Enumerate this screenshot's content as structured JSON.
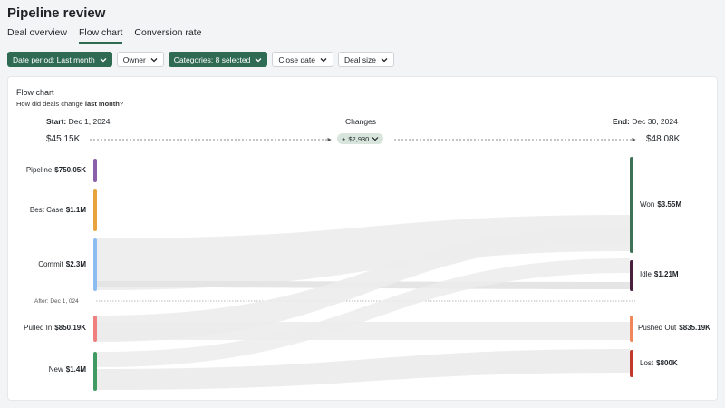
{
  "page": {
    "title": "Pipeline review"
  },
  "tabs": [
    {
      "label": "Deal overview",
      "active": false
    },
    {
      "label": "Flow chart",
      "active": true
    },
    {
      "label": "Conversion rate",
      "active": false
    }
  ],
  "filters": [
    {
      "label": "Date period: Last month",
      "selected": true
    },
    {
      "label": "Owner",
      "selected": false
    },
    {
      "label": "Categories: 8 selected",
      "selected": true
    },
    {
      "label": "Close date",
      "selected": false
    },
    {
      "label": "Deal size",
      "selected": false
    }
  ],
  "chart": {
    "title": "Flow chart",
    "subtitle_prefix": "How did deals change",
    "subtitle_bold": "last month",
    "subtitle_suffix": "?",
    "start_prefix": "Start:",
    "start_date": "Dec 1, 2024",
    "changes_label": "Changes",
    "end_prefix": "End:",
    "end_date": "Dec 30, 2024",
    "start_total": "$45.15K",
    "change_value": "$2,930",
    "end_total": "$48.08K",
    "after_label": "After: Dec 1, 024",
    "left_nodes": [
      {
        "name": "Pipeline",
        "value": "$750.05K",
        "color": "#8a5ea8"
      },
      {
        "name": "Best Case",
        "value": "$1.1M",
        "color": "#e8a33c"
      },
      {
        "name": "Commit",
        "value": "$2.3M",
        "color": "#8dbdf0"
      },
      {
        "name": "Pulled In",
        "value": "$850.19K",
        "color": "#ef8080"
      },
      {
        "name": "New",
        "value": "$1.4M",
        "color": "#3f9a63"
      }
    ],
    "right_nodes": [
      {
        "name": "Won",
        "value": "$3.55M",
        "color": "#3d7257"
      },
      {
        "name": "Idle",
        "value": "$1.21M",
        "color": "#4a1f3d"
      },
      {
        "name": "Pushed Out",
        "value": "$835.19K",
        "color": "#f0875a"
      },
      {
        "name": "Lost",
        "value": "$800K",
        "color": "#c0392b"
      }
    ],
    "flow_color": "#ececec"
  }
}
